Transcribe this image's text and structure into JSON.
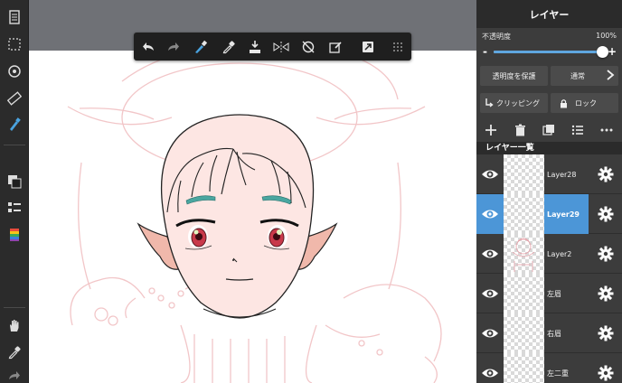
{
  "panel": {
    "title": "レイヤー",
    "opacity_label": "不透明度",
    "opacity_value": "100%",
    "opacity_fraction": 1.0,
    "minus": "-",
    "plus": "+",
    "protect_alpha_label": "透明度を保護",
    "blend_mode_label": "通常",
    "clipping_label": "クリッピング",
    "lock_label": "ロック",
    "layer_list_title": "レイヤー一覧"
  },
  "layers": [
    {
      "name": "Layer28",
      "selected": false
    },
    {
      "name": "Layer29",
      "selected": true
    },
    {
      "name": "Layer2",
      "selected": false
    },
    {
      "name": "左眉",
      "selected": false
    },
    {
      "name": "右眉",
      "selected": false
    },
    {
      "name": "左二重",
      "selected": false
    }
  ],
  "colors": {
    "selected": "#4c96d7",
    "accent_blue": "#5fa6df",
    "skin": "#fde6e3",
    "ear": "#f0b8ab",
    "brow": "#4aa6a0",
    "iris": "#c8394a"
  },
  "left_tools": [
    "pages-icon",
    "selection-icon",
    "transform-icon",
    "ruler-icon",
    "brush-icon",
    "layers-icon",
    "layer-list-icon",
    "color-icon",
    "hand-icon",
    "eyedropper-icon",
    "redo-icon"
  ],
  "float_tools": [
    "undo-icon",
    "redo-icon",
    "brush-eraser-icon",
    "eyedropper-icon",
    "fill-icon",
    "flip-icon",
    "rotate-icon",
    "clear-icon",
    "share-icon",
    "grid-menu-icon"
  ]
}
